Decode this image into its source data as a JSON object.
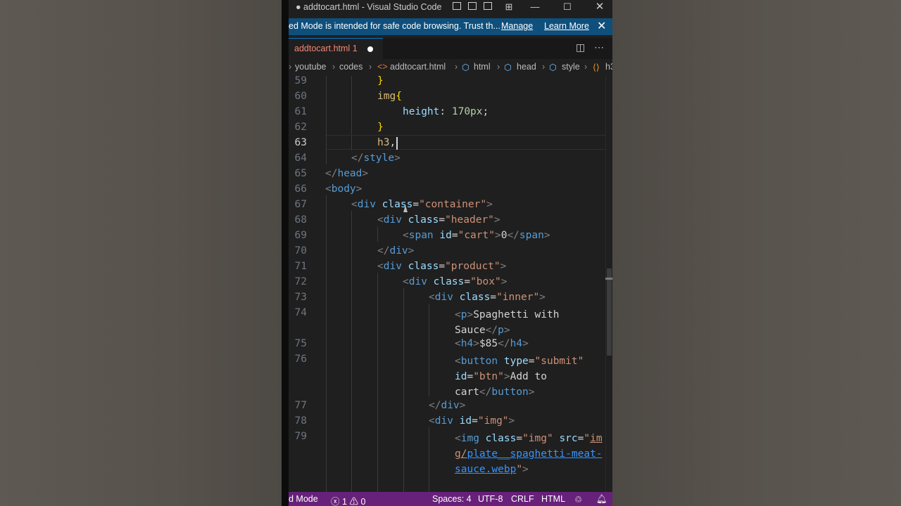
{
  "window": {
    "title": "● addtocart.html - Visual Studio Code",
    "minimize": "—",
    "maximize": "☐",
    "close": "✕"
  },
  "banner": {
    "message": "ed Mode is intended for safe code browsing. Trust th...",
    "manage": "Manage",
    "learn_more": "Learn More",
    "close": "✕"
  },
  "tab": {
    "filename": "addtocart.html",
    "problem_count": "1"
  },
  "breadcrumb": {
    "items": [
      "youtube",
      "codes",
      "addtocart.html",
      "html",
      "head",
      "style",
      "h3"
    ],
    "separator": ">"
  },
  "editor": {
    "current_line": "63",
    "lines": [
      {
        "n": "59",
        "text": "}"
      },
      {
        "n": "60",
        "text": "img{"
      },
      {
        "n": "61",
        "text": "height: 170px;"
      },
      {
        "n": "62",
        "text": "}"
      },
      {
        "n": "63",
        "text": "h3,"
      },
      {
        "n": "64",
        "text": "</style>"
      },
      {
        "n": "65",
        "text": "</head>"
      },
      {
        "n": "66",
        "text": "<body>"
      },
      {
        "n": "67",
        "text": "<div class=\"container\">"
      },
      {
        "n": "68",
        "text": "<div class=\"header\">"
      },
      {
        "n": "69",
        "text": "<span id=\"cart\">0</span>"
      },
      {
        "n": "70",
        "text": "</div>"
      },
      {
        "n": "71",
        "text": "<div class=\"product\">"
      },
      {
        "n": "72",
        "text": "<div class=\"box\">"
      },
      {
        "n": "73",
        "text": "<div class=\"inner\">"
      },
      {
        "n": "74",
        "text": "<p>Spaghetti with Sauce</p>"
      },
      {
        "n": "75",
        "text": "<h4>$85</h4>"
      },
      {
        "n": "76",
        "text": "<button type=\"submit\" id=\"btn\">Add to cart</button>"
      },
      {
        "n": "77",
        "text": "</div>"
      },
      {
        "n": "78",
        "text": "<div id=\"img\">"
      },
      {
        "n": "79",
        "text": "<img class=\"img\" src=\"img/plate__spaghetti-meat-sauce.webp\">"
      }
    ]
  },
  "statusbar": {
    "mode": "d Mode",
    "errors": "1",
    "warnings": "0",
    "spaces": "Spaces: 4",
    "encoding": "UTF-8",
    "eol": "CRLF",
    "language": "HTML"
  },
  "colors": {
    "accent_blue": "#0e4f7c",
    "status_purple": "#68217a",
    "editor_bg": "#1f1f1f",
    "tab_error": "#f48771"
  }
}
